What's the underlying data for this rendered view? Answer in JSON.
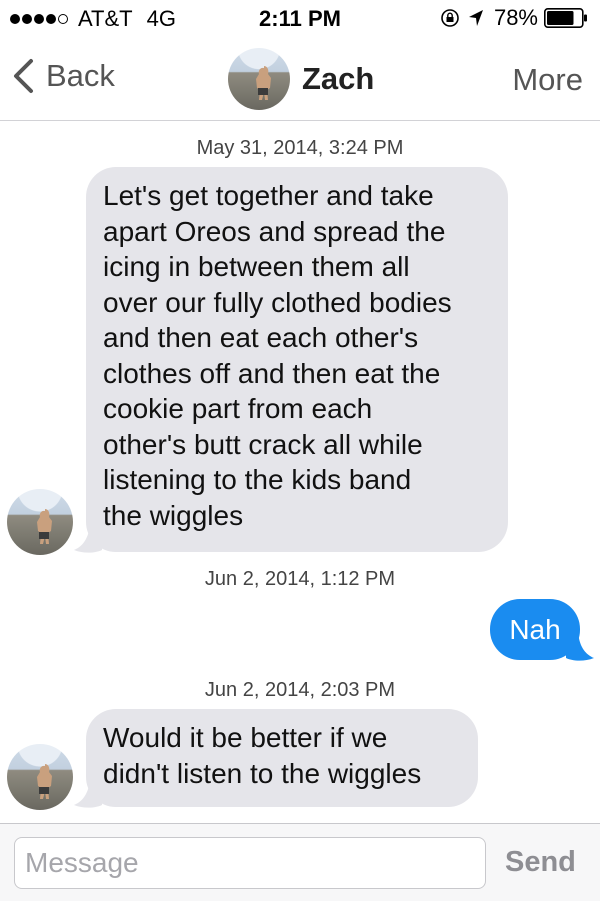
{
  "status_bar": {
    "carrier": "AT&T",
    "network": "4G",
    "time": "2:11 PM",
    "battery": "78%",
    "battery_level": 0.78,
    "signal_bars": 4
  },
  "nav": {
    "back_label": "Back",
    "contact_name": "Zach",
    "more_label": "More"
  },
  "conversation": {
    "timestamps": [
      "May 31, 2014, 3:24 PM",
      "Jun 2, 2014, 1:12 PM",
      "Jun 2, 2014, 2:03 PM"
    ],
    "messages": [
      {
        "direction": "incoming",
        "lines": [
          "Let's get together and take",
          "apart Oreos and spread the",
          "icing in between them all",
          "over our fully clothed bodies",
          "and then eat each other's",
          "clothes off and then eat the",
          "cookie part from each",
          "other's butt crack all while",
          "listening to the kids band",
          "the wiggles"
        ]
      },
      {
        "direction": "outgoing",
        "lines": [
          "Nah"
        ]
      },
      {
        "direction": "incoming",
        "lines": [
          "Would it be better if we",
          "didn't listen to the wiggles"
        ]
      }
    ]
  },
  "composer": {
    "placeholder": "Message",
    "send_label": "Send"
  },
  "colors": {
    "incoming_bubble": "#e5e5ea",
    "outgoing_bubble": "#1a8cf0",
    "send_disabled": "#8e8e93"
  },
  "icons": [
    "signal-dots",
    "rotation-lock-icon",
    "location-arrow-icon",
    "battery-icon",
    "back-chevron-icon"
  ]
}
